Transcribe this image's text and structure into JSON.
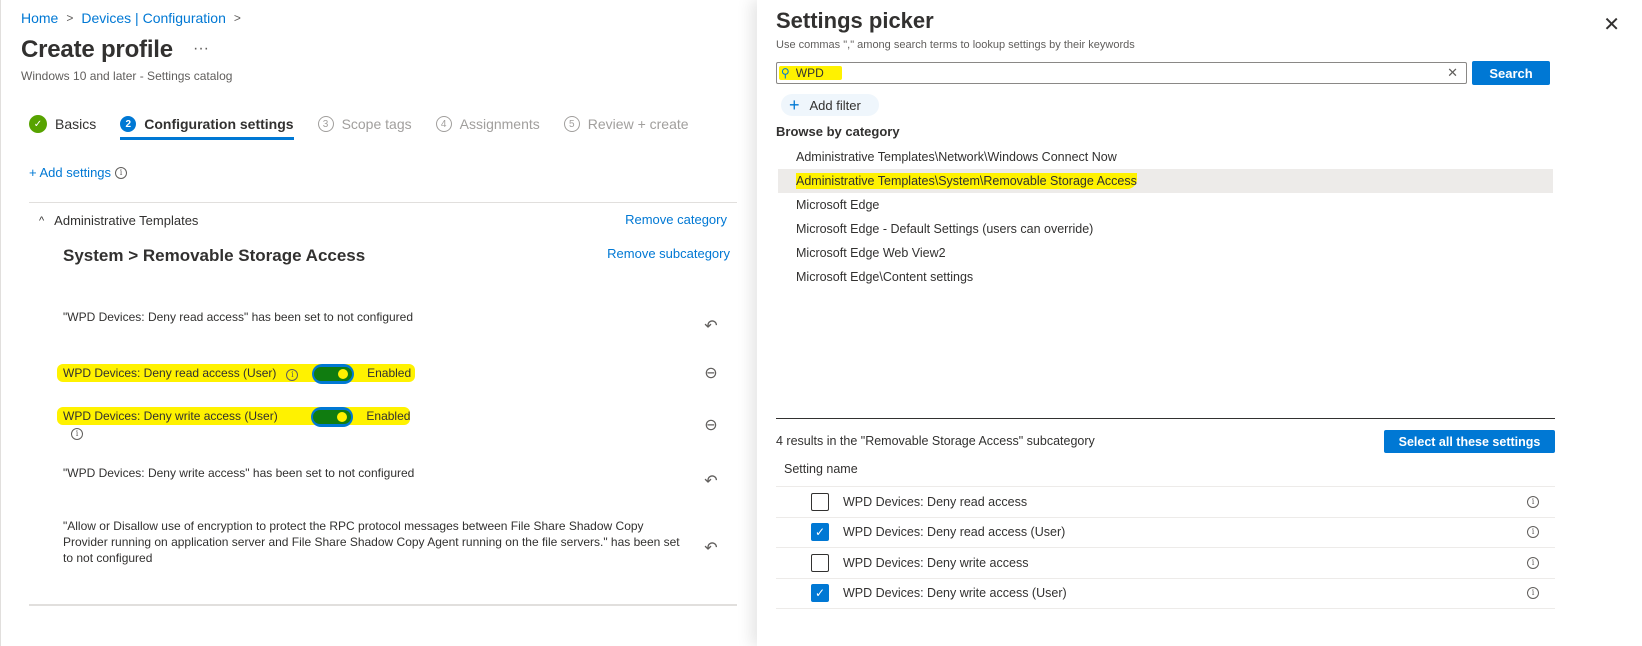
{
  "breadcrumb": [
    {
      "label": "Home"
    },
    {
      "label": "Devices | Configuration"
    }
  ],
  "breadcrumb_sep": ">",
  "page": {
    "title": "Create profile",
    "more_label": "···",
    "subtitle": "Windows 10 and later - Settings catalog"
  },
  "steps": [
    {
      "num": "✓",
      "label": "Basics",
      "state": "done"
    },
    {
      "num": "2",
      "label": "Configuration settings",
      "state": "active"
    },
    {
      "num": "3",
      "label": "Scope tags",
      "state": "pending"
    },
    {
      "num": "4",
      "label": "Assignments",
      "state": "pending"
    },
    {
      "num": "5",
      "label": "Review + create",
      "state": "pending"
    }
  ],
  "add_settings_label": "+ Add settings",
  "info_glyph": "i",
  "category": {
    "name": "Administrative Templates",
    "chevron": "^",
    "remove_label": "Remove category",
    "subcategory": "System > Removable Storage Access",
    "remove_sub_label": "Remove subcategory"
  },
  "settings": [
    {
      "type": "notice",
      "text": "\"WPD Devices: Deny read access\" has been set to not configured",
      "action_icon": "undo-icon",
      "glyph": "↶"
    },
    {
      "type": "toggle",
      "label": "WPD Devices: Deny read access (User)",
      "value": "Enabled",
      "on": true,
      "action_icon": "remove-icon",
      "glyph": "⊖"
    },
    {
      "type": "toggle",
      "label": "WPD Devices: Deny write access (User)",
      "value": "Enabled",
      "on": true,
      "action_icon": "remove-icon",
      "glyph": "⊖"
    },
    {
      "type": "notice",
      "text": "\"WPD Devices: Deny write access\" has been set to not configured",
      "action_icon": "undo-icon",
      "glyph": "↶"
    },
    {
      "type": "notice",
      "text": "\"Allow or Disallow use of encryption to protect the RPC protocol messages between File Share Shadow Copy Provider running on application server and File Share Shadow Copy Agent running on the file servers.\" has been set to not configured",
      "action_icon": "undo-icon",
      "glyph": "↶"
    }
  ],
  "picker": {
    "title": "Settings picker",
    "close_glyph": "✕",
    "hint": "Use commas \",\" among search terms to lookup settings by their keywords",
    "search_value": "WPD",
    "search_placeholder": "",
    "search_icon_glyph": "⚲",
    "clear_glyph": "✕",
    "search_button": "Search",
    "add_filter_label": "Add filter",
    "add_filter_glyph": "+",
    "browse_label": "Browse by category",
    "categories": [
      {
        "label": "Administrative Templates\\Network\\Windows Connect Now",
        "selected": false
      },
      {
        "label": "Administrative Templates\\System\\Removable Storage Access",
        "selected": true
      },
      {
        "label": "Microsoft Edge",
        "selected": false
      },
      {
        "label": "Microsoft Edge - Default Settings (users can override)",
        "selected": false
      },
      {
        "label": "Microsoft Edge Web View2",
        "selected": false
      },
      {
        "label": "Microsoft Edge\\Content settings",
        "selected": false
      }
    ],
    "results_text": "4 results in the \"Removable Storage Access\" subcategory",
    "select_all_label": "Select all these settings",
    "column_header": "Setting name",
    "results": [
      {
        "name": "WPD Devices: Deny read access",
        "checked": false
      },
      {
        "name": "WPD Devices: Deny read access (User)",
        "checked": true
      },
      {
        "name": "WPD Devices: Deny write access",
        "checked": false
      },
      {
        "name": "WPD Devices: Deny write access (User)",
        "checked": true
      }
    ]
  },
  "colors": {
    "accent": "#0078d4",
    "done_green": "#57a300",
    "toggle_track": "#107c10",
    "highlight": "#fff200",
    "selected_row": "#edebe9"
  }
}
